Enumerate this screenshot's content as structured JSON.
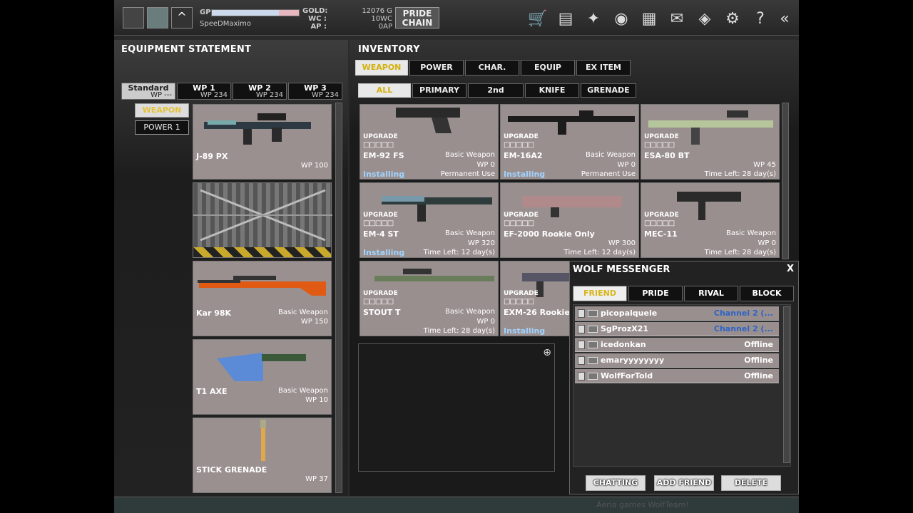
{
  "topbar": {
    "gp_label": "GP",
    "username": "SpeeDMaximo",
    "currency_labels": [
      "GOLD:",
      "WC :",
      "AP :"
    ],
    "currency_values": [
      "12076 G",
      "10WC",
      "0AP"
    ],
    "pride_chain_line1": "PRIDE",
    "pride_chain_line2": "CHAIN",
    "gp_progress": 0.77
  },
  "equipment": {
    "title": "EQUIPMENT STATEMENT",
    "tabs": [
      {
        "label": "Standard",
        "wp": "WP ---"
      },
      {
        "label": "WP 1",
        "wp": "WP 234"
      },
      {
        "label": "WP 2",
        "wp": "WP 234"
      },
      {
        "label": "WP 3",
        "wp": "WP 234"
      }
    ],
    "slot_buttons": [
      "WEAPON",
      "POWER 1"
    ],
    "cards": [
      {
        "name": "J-89 PX",
        "type": "",
        "wp": "WP 100"
      },
      {
        "name": "",
        "type": "",
        "wp": ""
      },
      {
        "name": "Kar 98K",
        "type": "Basic Weapon",
        "wp": "WP 150"
      },
      {
        "name": "T1 AXE",
        "type": "Basic Weapon",
        "wp": "WP 10"
      },
      {
        "name": "STICK GRENADE",
        "type": "",
        "wp": "WP 37"
      }
    ]
  },
  "inventory": {
    "title": "INVENTORY",
    "main_tabs": [
      "WEAPON",
      "POWER",
      "CHAR.",
      "EQUIP",
      "EX ITEM"
    ],
    "sub_tabs": [
      "ALL",
      "PRIMARY",
      "2nd",
      "KNIFE",
      "GRENADE"
    ],
    "upgrade_label": "UPGRADE",
    "upgrade_boxes": "□□□□□",
    "items": [
      {
        "name": "EM-92 FS",
        "type": "Basic Weapon",
        "wp": "WP 0",
        "status": "Installing",
        "use": "Permanent Use"
      },
      {
        "name": "EM-16A2",
        "type": "Basic Weapon",
        "wp": "WP 0",
        "status": "Installing",
        "use": "Permanent Use"
      },
      {
        "name": "ESA-80 BT",
        "type": "",
        "wp": "WP 45",
        "status": "",
        "use": "Time Left: 28 day(s)"
      },
      {
        "name": "EM-4 ST",
        "type": "Basic Weapon",
        "wp": "WP 320",
        "status": "Installing",
        "use": "Time Left: 12 day(s)"
      },
      {
        "name": "EF-2000 Rookie Only",
        "type": "",
        "wp": "WP 300",
        "status": "",
        "use": "Time Left: 12 day(s)"
      },
      {
        "name": "MEC-11",
        "type": "Basic Weapon",
        "wp": "WP 0",
        "status": "",
        "use": "Time Left: 28 day(s)"
      },
      {
        "name": "STOUT T",
        "type": "Basic Weapon",
        "wp": "WP 0",
        "status": "",
        "use": "Time Left: 28 day(s)"
      },
      {
        "name": "EXM-26 Rookie",
        "type": "",
        "wp": "",
        "status": "Installing",
        "use": ""
      }
    ]
  },
  "messenger": {
    "title": "WOLF MESSENGER",
    "close": "X",
    "tabs": [
      "FRIEND",
      "PRIDE",
      "RIVAL",
      "BLOCK"
    ],
    "friends": [
      {
        "name": "picopalquele",
        "status": "Channel 2 (..."
      },
      {
        "name": "SgProzX21",
        "status": "Channel 2 (..."
      },
      {
        "name": "icedonkan",
        "status": "Offline"
      },
      {
        "name": "emaryyyyyyyy",
        "status": "Offline"
      },
      {
        "name": "WolfForTold",
        "status": "Offline"
      }
    ],
    "buttons": [
      "CHATTING",
      "ADD FRIEND",
      "DELETE"
    ]
  },
  "chat": {
    "line": "Aeria games WolfTeam!"
  },
  "colors": {
    "accent_yellow": "#d8b51a",
    "installing_blue": "#9fd3ff",
    "channel_blue": "#2c64c6"
  }
}
